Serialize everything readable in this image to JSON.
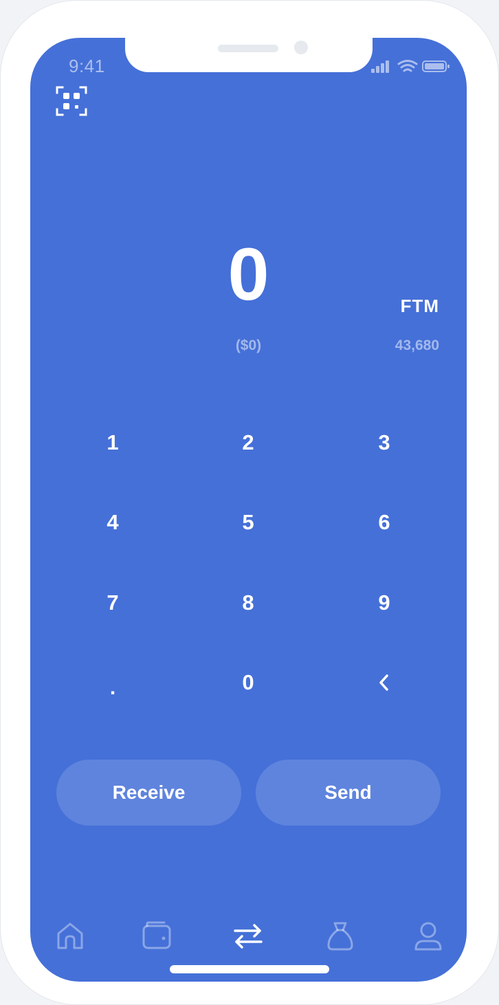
{
  "status_bar": {
    "time": "9:41"
  },
  "amount": {
    "value": "0",
    "currency": "FTM",
    "fiat": "($0)",
    "balance": "43,680"
  },
  "keypad": {
    "k1": "1",
    "k2": "2",
    "k3": "3",
    "k4": "4",
    "k5": "5",
    "k6": "6",
    "k7": "7",
    "k8": "8",
    "k9": "9",
    "dot": ".",
    "k0": "0",
    "back": "‹"
  },
  "actions": {
    "receive_label": "Receive",
    "send_label": "Send"
  },
  "tab_bar": {
    "tabs": [
      "home-icon",
      "wallet-icon",
      "transfer-icon",
      "money-bag-icon",
      "user-icon"
    ],
    "active": "transfer-icon"
  },
  "colors": {
    "screen_background": "#4570d8",
    "device_frame": "#ffffff",
    "accent_text": "#ffffff"
  }
}
